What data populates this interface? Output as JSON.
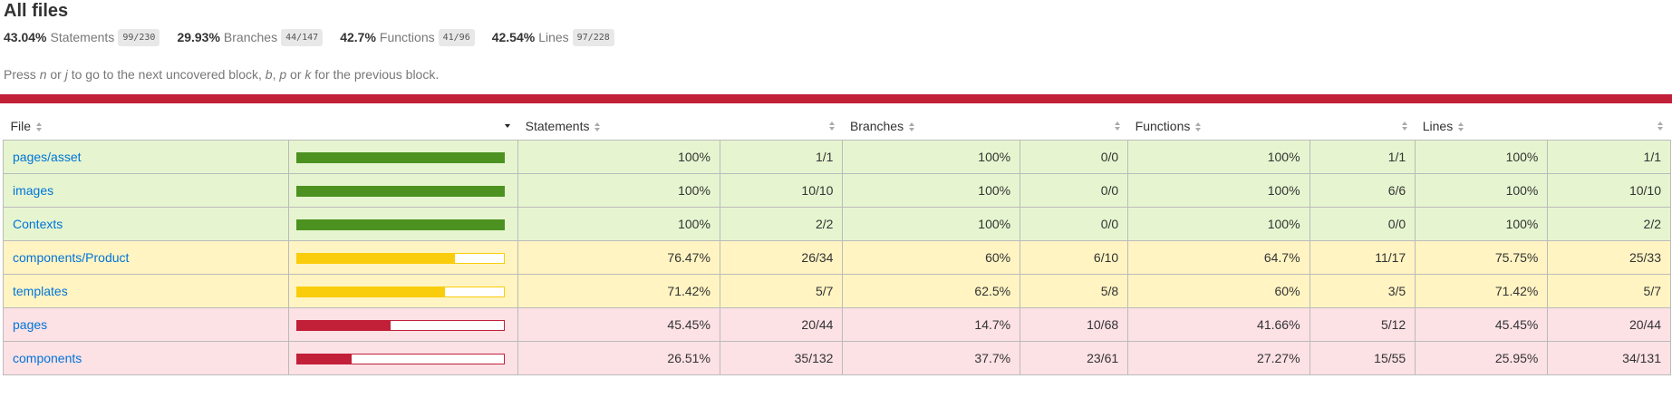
{
  "title": "All files",
  "summary": [
    {
      "pct": "43.04%",
      "label": "Statements",
      "fraction": "99/230"
    },
    {
      "pct": "29.93%",
      "label": "Branches",
      "fraction": "44/147"
    },
    {
      "pct": "42.7%",
      "label": "Functions",
      "fraction": "41/96"
    },
    {
      "pct": "42.54%",
      "label": "Lines",
      "fraction": "97/228"
    }
  ],
  "hint": {
    "press": "Press",
    "n": "n",
    "or1": "or",
    "j": "j",
    "mid": "to go to the next uncovered block,",
    "b": "b",
    "comma": ",",
    "p": "p",
    "or2": "or",
    "k": "k",
    "end": "for the previous block."
  },
  "columns": {
    "file": "File",
    "statements": "Statements",
    "branches": "Branches",
    "functions": "Functions",
    "lines": "Lines"
  },
  "status_colors": {
    "high": "#4d9221",
    "medium": "#f9cd0b",
    "low": "#c21f39",
    "link": "#0074d9"
  },
  "rows": [
    {
      "file": "pages/asset",
      "level": "high",
      "coverage": 1.0,
      "stmt_pct": "100%",
      "stmt_abs": "1/1",
      "br_pct": "100%",
      "br_abs": "0/0",
      "fn_pct": "100%",
      "fn_abs": "1/1",
      "ln_pct": "100%",
      "ln_abs": "1/1"
    },
    {
      "file": "images",
      "level": "high",
      "coverage": 1.0,
      "stmt_pct": "100%",
      "stmt_abs": "10/10",
      "br_pct": "100%",
      "br_abs": "0/0",
      "fn_pct": "100%",
      "fn_abs": "6/6",
      "ln_pct": "100%",
      "ln_abs": "10/10"
    },
    {
      "file": "Contexts",
      "level": "high",
      "coverage": 1.0,
      "stmt_pct": "100%",
      "stmt_abs": "2/2",
      "br_pct": "100%",
      "br_abs": "0/0",
      "fn_pct": "100%",
      "fn_abs": "0/0",
      "ln_pct": "100%",
      "ln_abs": "2/2"
    },
    {
      "file": "components/Product",
      "level": "medium",
      "coverage": 0.7647,
      "stmt_pct": "76.47%",
      "stmt_abs": "26/34",
      "br_pct": "60%",
      "br_abs": "6/10",
      "fn_pct": "64.7%",
      "fn_abs": "11/17",
      "ln_pct": "75.75%",
      "ln_abs": "25/33"
    },
    {
      "file": "templates",
      "level": "medium",
      "coverage": 0.7142,
      "stmt_pct": "71.42%",
      "stmt_abs": "5/7",
      "br_pct": "62.5%",
      "br_abs": "5/8",
      "fn_pct": "60%",
      "fn_abs": "3/5",
      "ln_pct": "71.42%",
      "ln_abs": "5/7"
    },
    {
      "file": "pages",
      "level": "low",
      "coverage": 0.4545,
      "stmt_pct": "45.45%",
      "stmt_abs": "20/44",
      "br_pct": "14.7%",
      "br_abs": "10/68",
      "fn_pct": "41.66%",
      "fn_abs": "5/12",
      "ln_pct": "45.45%",
      "ln_abs": "20/44"
    },
    {
      "file": "components",
      "level": "low",
      "coverage": 0.2651,
      "stmt_pct": "26.51%",
      "stmt_abs": "35/132",
      "br_pct": "37.7%",
      "br_abs": "23/61",
      "fn_pct": "27.27%",
      "fn_abs": "15/55",
      "ln_pct": "25.95%",
      "ln_abs": "34/131"
    }
  ]
}
